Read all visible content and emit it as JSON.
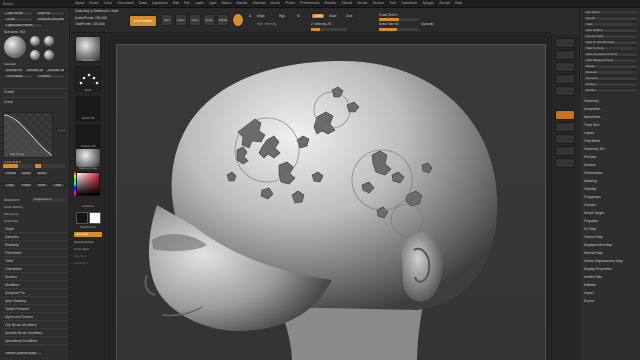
{
  "app": {
    "title": "Brush"
  },
  "menus": [
    "Alpha",
    "Brush",
    "Color",
    "Document",
    "Draw",
    "Dynamics",
    "Edit",
    "File",
    "Layer",
    "Light",
    "Macro",
    "Marker",
    "Material",
    "Movie",
    "Picker",
    "Preferences",
    "Render",
    "Stencil",
    "Stroke",
    "Texture",
    "Tool",
    "Transform",
    "Zplugin",
    "Zscript",
    "Help"
  ],
  "left_tray": {
    "header_buttons": [
      "Load Brush",
      "Save As",
      "Clone",
      "Reset All Brushes",
      "LightBox▸Brushes"
    ],
    "brush_name": "Standard. 563",
    "brush_labels": [
      "Standard",
      "Clay",
      "Move",
      "Smooth"
    ],
    "sub_buttons": [
      "Smooth Peaks",
      "Smooth Valleys",
      "Smooth Stronger",
      "Front Mask",
      "To Mesh"
    ],
    "section_create": "Create",
    "section_curve": "Curve",
    "edit_curve": "Edit Curve",
    "curve_controls": [
      "Focal Shift 0",
      "Preview",
      "Noise",
      "Bend",
      "Copy",
      "Paste",
      "Save",
      "Load"
    ],
    "accu_curve": "AccuCurve",
    "wrap_mode": "WrapMode 0",
    "curve_items": [
      "Curve Bi-Prim",
      "Pen Curve",
      "Curve Pen"
    ],
    "accordion": [
      "Depth",
      "Samples",
      "Elasticity",
      "FiberMesh",
      "Twist",
      "Orientation",
      "Surface",
      "Modifiers",
      "Sculptris Pro",
      "Auto Masking",
      "Tablet Pressure",
      "Alpha and Texture",
      "Clip Brush Modifiers",
      "Smooth Brush Modifiers",
      "NanoMesh Modifiers"
    ],
    "reset_button": "Reset Current Brush"
  },
  "shelf": {
    "tiles": [
      "Standard",
      "Dots",
      "Alpha Off",
      "Texture Off",
      "MatCap Gray"
    ],
    "gradient": "Gradient",
    "switch_color": "SwitchColor",
    "alternate": "Alternate",
    "extra": [
      "BackfaceMask",
      "Array Mesh",
      "Live Bool",
      "Local Sym"
    ]
  },
  "toolbar": {
    "undo_info": "Switching to Sidebrush: Head",
    "active_points": "ActivePoints: 165,466",
    "total_points": "TotalPoints: 165,466",
    "light_box": "Light Box",
    "live_boolean": "Live Boolean",
    "edit": "Edit",
    "draw": "Draw",
    "move": "Move",
    "scale": "Scale",
    "rotate": "Rotate",
    "mode_a": "A",
    "mrgb": "Mrgb",
    "rgb": "Rgb",
    "m": "M",
    "zadd": "Zadd",
    "zsub": "Zsub",
    "zcut": "Zcut",
    "rgb_intensity": "Rgb Intensity",
    "z_intensity": "Z Intensity 25",
    "focal_shift": "Focal Shift 0",
    "draw_size": "Draw Size 64",
    "dynamic": "Dynamic",
    "z_intensity_value": 0.25,
    "draw_size_value": 0.45
  },
  "right_tray": {
    "top_buttons": [
      "Get Other",
      "Set All",
      "Split",
      "Split Hidden",
      "Groups Split",
      "Split To Similar Parts",
      "Split To Parts",
      "Split Unmasked Points",
      "Split Masked Points",
      "Merge",
      "Boolean",
      "Remesh",
      "Project",
      "Extract"
    ],
    "sections": [
      "Geometry",
      "ArrayMesh",
      "NanoMesh",
      "Thick Skin",
      "Layers",
      "FiberMesh",
      "Geometry HD",
      "Preview",
      "Surface",
      "Deformation",
      "Masking",
      "Visibility",
      "Polygroups",
      "Contact",
      "Morph Target",
      "Polypaint",
      "UV Map",
      "Texture Map",
      "Displacement Map",
      "Normal Map",
      "Vector Displacement Map",
      "Display Properties",
      "Unified Skin",
      "Initialize",
      "Import",
      "Export"
    ]
  },
  "colors": {
    "accent": "#d98c2b",
    "panel": "#2e2e2e",
    "viewport": "#343434"
  }
}
